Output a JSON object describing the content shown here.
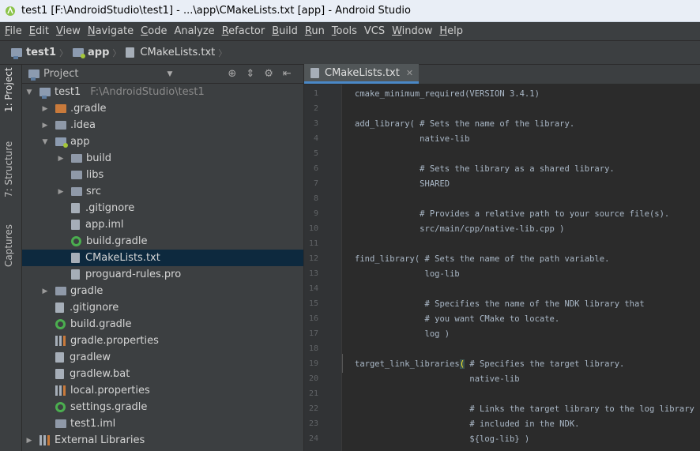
{
  "window": {
    "title": "test1 [F:\\AndroidStudio\\test1] - ...\\app\\CMakeLists.txt [app] - Android Studio"
  },
  "menu": [
    {
      "u": "F",
      "rest": "ile"
    },
    {
      "u": "E",
      "rest": "dit"
    },
    {
      "u": "V",
      "rest": "iew"
    },
    {
      "u": "N",
      "rest": "avigate"
    },
    {
      "u": "C",
      "rest": "ode"
    },
    {
      "u": "",
      "rest": "Analyze"
    },
    {
      "u": "R",
      "rest": "efactor"
    },
    {
      "u": "B",
      "rest": "uild"
    },
    {
      "u": "R",
      "rest": "un"
    },
    {
      "u": "T",
      "rest": "ools"
    },
    {
      "u": "",
      "rest": "VCS"
    },
    {
      "u": "W",
      "rest": "indow"
    },
    {
      "u": "H",
      "rest": "elp"
    }
  ],
  "breadcrumb": {
    "root": "test1",
    "module": "app",
    "file": "CMakeLists.txt"
  },
  "sidetabs": {
    "project": "1: Project",
    "structure": "7: Structure",
    "captures": "Captures"
  },
  "project_panel": {
    "view_label": "Project",
    "root": {
      "name": "test1",
      "path": "F:\\AndroidStudio\\test1"
    },
    "items": [
      {
        "name": ".gradle"
      },
      {
        "name": ".idea"
      },
      {
        "name": "app"
      },
      {
        "name": "build"
      },
      {
        "name": "libs"
      },
      {
        "name": "src"
      },
      {
        "name": ".gitignore"
      },
      {
        "name": "app.iml"
      },
      {
        "name": "build.gradle"
      },
      {
        "name": "CMakeLists.txt"
      },
      {
        "name": "proguard-rules.pro"
      },
      {
        "name": "gradle"
      },
      {
        "name": ".gitignore"
      },
      {
        "name": "build.gradle"
      },
      {
        "name": "gradle.properties"
      },
      {
        "name": "gradlew"
      },
      {
        "name": "gradlew.bat"
      },
      {
        "name": "local.properties"
      },
      {
        "name": "settings.gradle"
      },
      {
        "name": "test1.iml"
      },
      {
        "name": "External Libraries"
      }
    ]
  },
  "editor": {
    "tab_label": "CMakeLists.txt",
    "lines": [
      "cmake_minimum_required(VERSION 3.4.1)",
      "",
      "add_library( # Sets the name of the library.",
      "             native-lib",
      "",
      "             # Sets the library as a shared library.",
      "             SHARED",
      "",
      "             # Provides a relative path to your source file(s).",
      "             src/main/cpp/native-lib.cpp )",
      "",
      "find_library( # Sets the name of the path variable.",
      "              log-lib",
      "",
      "              # Specifies the name of the NDK library that",
      "              # you want CMake to locate.",
      "              log )",
      "",
      "target_link_libraries",
      "                       native-lib",
      "",
      "                       # Links the target library to the log library",
      "                       # included in the NDK.",
      "                       ${log-lib} )"
    ],
    "line19_paren": "(",
    "line19_rest": " # Specifies the target library."
  }
}
